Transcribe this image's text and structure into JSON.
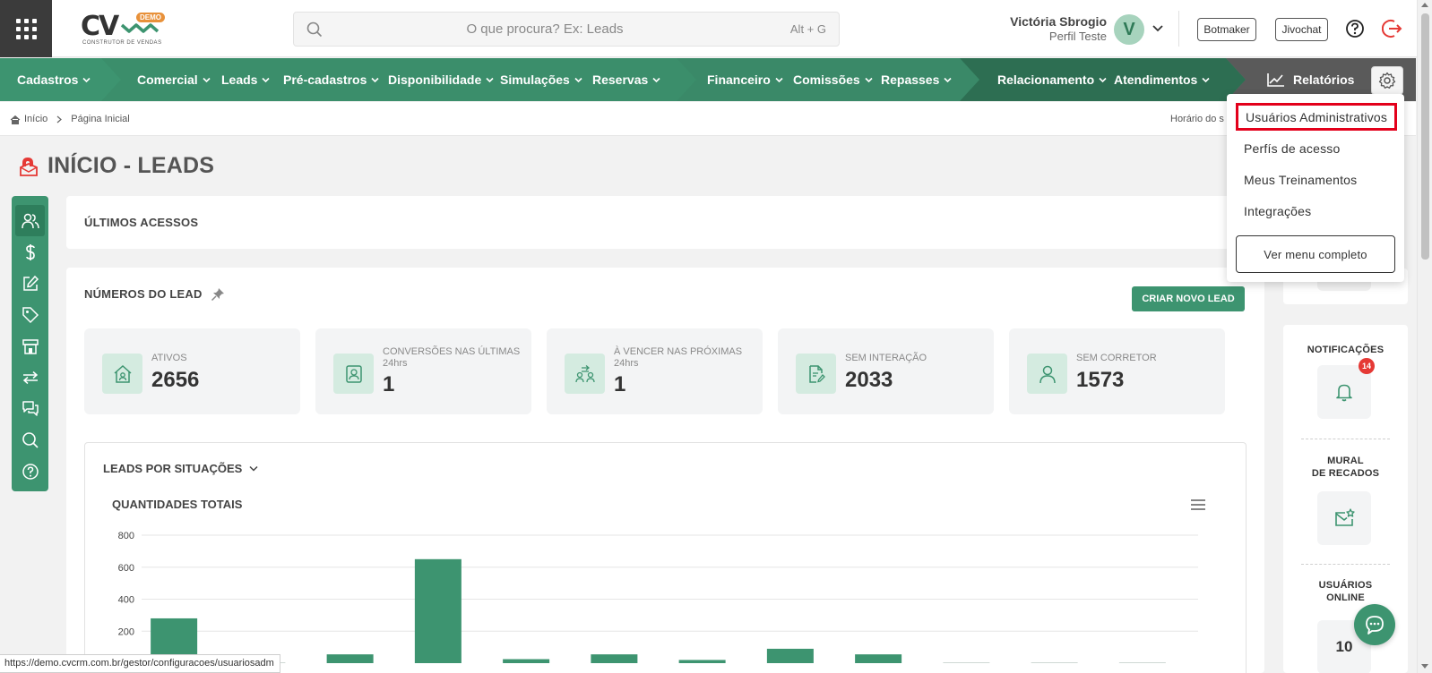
{
  "header": {
    "logo": {
      "mark": "CV",
      "demo_badge": "DEMO",
      "tagline": "CONSTRUTOR DE VENDAS"
    },
    "search": {
      "placeholder": "O que procura? Ex: Leads",
      "shortcut": "Alt + G"
    },
    "user": {
      "name": "Victória Sbrogio",
      "profile": "Perfil Teste",
      "initial": "V"
    },
    "buttons": {
      "botmaker": "Botmaker",
      "jivochat": "Jivochat"
    }
  },
  "nav": {
    "groups": [
      {
        "color": "#3d9470",
        "items": [
          "Cadastros"
        ]
      },
      {
        "color": "#3d9470",
        "items": [
          "Comercial",
          "Leads",
          "Pré-cadastros",
          "Disponibilidade",
          "Simulações",
          "Reservas"
        ]
      },
      {
        "color": "#3d9470",
        "items": [
          "Financeiro",
          "Comissões",
          "Repasses"
        ]
      },
      {
        "color": "#3d9470",
        "items": [
          "Relacionamento",
          "Atendimentos"
        ]
      }
    ],
    "reports": "Relatórios"
  },
  "breadcrumb": {
    "home": "Início",
    "current": "Página Inicial",
    "server_time": "Horário do s"
  },
  "page": {
    "title": "INÍCIO - LEADS"
  },
  "sections": {
    "last_access": "ÚLTIMOS ACESSOS",
    "numbers": "NÚMEROS DO LEAD",
    "new_lead_button": "CRIAR NOVO LEAD"
  },
  "stats": [
    {
      "label": "ATIVOS",
      "value": "2656",
      "icon": "home-icon"
    },
    {
      "label": "CONVERSÕES NAS ÚLTIMAS 24hrs",
      "value": "1",
      "icon": "user-badge-icon"
    },
    {
      "label": "À VENCER NAS PRÓXIMAS 24hrs",
      "value": "1",
      "icon": "people-swap-icon"
    },
    {
      "label": "SEM INTERAÇÃO",
      "value": "2033",
      "icon": "document-edit-icon"
    },
    {
      "label": "SEM CORRETOR",
      "value": "1573",
      "icon": "user-icon"
    }
  ],
  "chart_section": {
    "selector": "LEADS POR SITUAÇÕES"
  },
  "chart_data": {
    "type": "bar",
    "title": "QUANTIDADES TOTAIS",
    "color": "#3d9470",
    "yticks": [
      200,
      400,
      600,
      800
    ],
    "ylim": [
      0,
      800
    ],
    "values": [
      280,
      0,
      55,
      650,
      25,
      55,
      20,
      90,
      55,
      3,
      3,
      3
    ]
  },
  "side": {
    "notifications": {
      "label": "NOTIFICAÇÕES",
      "badge": "14"
    },
    "mural": {
      "label_line1": "MURAL",
      "label_line2": "DE RECADOS"
    },
    "online": {
      "label_line1": "USUÁRIOS",
      "label_line2": "ONLINE",
      "count": "10"
    }
  },
  "dropdown": {
    "items": [
      "Usuários Administrativos",
      "Perfís de acesso",
      "Meus Treinamentos",
      "Integrações"
    ],
    "full_menu": "Ver menu completo",
    "highlight_color": "#e3001b"
  },
  "status_url": "https://demo.cvcrm.com.br/gestor/configuracoes/usuariosadm"
}
